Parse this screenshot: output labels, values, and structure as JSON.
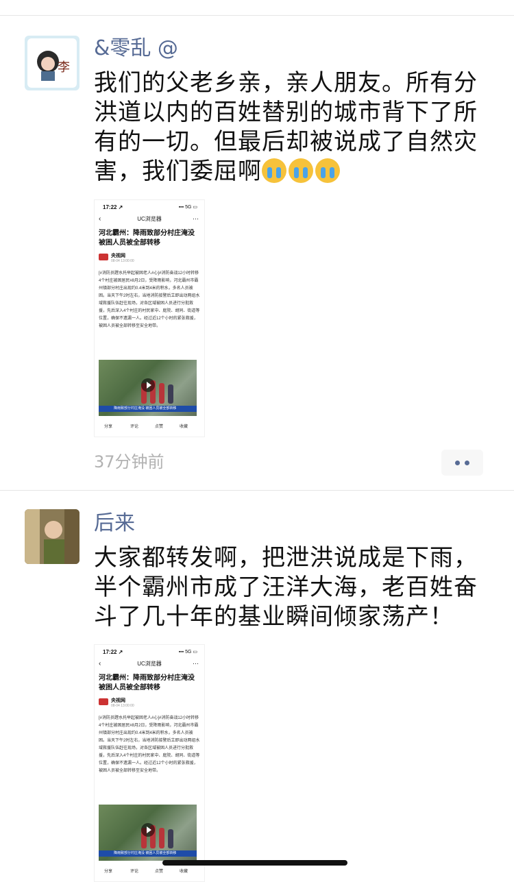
{
  "moments": [
    {
      "username": "&零乱 @",
      "avatar_text": "李",
      "text_parts": [
        "我们的父老乡亲，亲人朋友。所有分洪道以内的百姓替别的城市背下了所有的一切。但最后却被说成了自然灾害，我们委屈啊"
      ],
      "emoji_count": 3,
      "emoji_name": "crying-face",
      "time": "37分钟前",
      "shared_screenshot": {
        "status_time": "17:22 ↗",
        "status_right": "▪▪▪ 5G ▭",
        "browser": "UC浏览器",
        "back": "‹",
        "more": "⋯",
        "title": "河北霸州：降雨致部分村庄淹没 被困人员被全部转移",
        "source": "央视网",
        "date": "08-04 13:00:00",
        "body": "[#消防员蹚水托举起被困老人#心]#消防奋战12小时转移4个村庄被困居民#8月2日，受降雨影响，河北霸州市霸州镇部分村庄出现约0.4米到4米的积水，多名人员被困。当天下午2时左右，当地消防接警后立即出动两组水域救援队伍赶往现场，对各区域被困人员进行分批救援，先后深入4个村庄的村民家中、庭院、胡同、街道等位置，确保不遗漏一人。经过近12个小时的紧张救援，被困人员被全部转移至安全地带。",
        "video_banner": "降雨致部分村庄淹没 被困人员被全部转移",
        "actions": [
          "分享",
          "评论",
          "点赞",
          "收藏"
        ]
      }
    },
    {
      "username": "后来",
      "text_parts": [
        "大家都转发啊，把泄洪说成是下雨，半个霸州市成了汪洋大海，老百姓奋斗了几十年的基业瞬间倾家荡产！"
      ],
      "shared_screenshot": {
        "status_time": "17:22 ↗",
        "status_right": "▪▪▪ 5G ▭",
        "browser": "UC浏览器",
        "back": "‹",
        "more": "⋯",
        "title": "河北霸州：降雨致部分村庄淹没 被困人员被全部转移",
        "source": "央视网",
        "date": "08-04 13:00:00",
        "body": "[#消防员蹚水托举起被困老人#心]#消防奋战12小时转移4个村庄被困居民#8月2日，受降雨影响，河北霸州市霸州镇部分村庄出现约0.4米到4米的积水，多名人员被困。当天下午2时左右，当地消防接警后立即出动两组水域救援队伍赶往现场，对各区域被困人员进行分批救援，先后深入4个村庄的村民家中、庭院、胡同、街道等位置，确保不遗漏一人。经过近12个小时的紧张救援，被困人员被全部转移至安全地带。",
        "video_banner": "降雨致部分村庄淹没 被困人员被全部转移",
        "actions": [
          "分享",
          "评论",
          "点赞",
          "收藏"
        ]
      }
    }
  ],
  "colors": {
    "username": "#576b95",
    "time": "#b2b2b2",
    "divider": "#e5e5e5"
  }
}
